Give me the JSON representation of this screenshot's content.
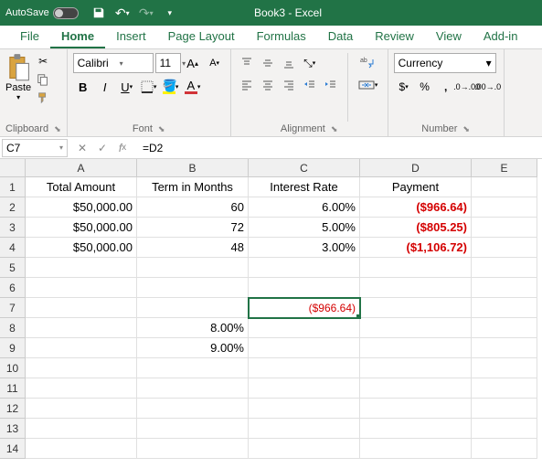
{
  "titlebar": {
    "autosave": "AutoSave",
    "doc": "Book3  -  Excel"
  },
  "tabs": [
    "File",
    "Home",
    "Insert",
    "Page Layout",
    "Formulas",
    "Data",
    "Review",
    "View",
    "Add-in"
  ],
  "active_tab": 1,
  "ribbon": {
    "clipboard": {
      "paste": "Paste",
      "label": "Clipboard"
    },
    "font": {
      "name": "Calibri",
      "size": "11",
      "label": "Font"
    },
    "alignment": {
      "label": "Alignment"
    },
    "number": {
      "format": "Currency",
      "label": "Number"
    }
  },
  "namebox": "C7",
  "formula": "=D2",
  "columns": [
    "A",
    "B",
    "C",
    "D",
    "E"
  ],
  "rows": [
    "1",
    "2",
    "3",
    "4",
    "5",
    "6",
    "7",
    "8",
    "9",
    "10",
    "11",
    "12",
    "13",
    "14"
  ],
  "col_widths": [
    "wA",
    "wB",
    "wC",
    "wD",
    "wE"
  ],
  "sheet": {
    "headers": [
      "Total Amount",
      "Term in Months",
      "Interest Rate",
      "Payment"
    ],
    "r2": {
      "a": "$50,000.00",
      "b": "60",
      "c": "6.00%",
      "d": "($966.64)"
    },
    "r3": {
      "a": "$50,000.00",
      "b": "72",
      "c": "5.00%",
      "d": "($805.25)"
    },
    "r4": {
      "a": "$50,000.00",
      "b": "48",
      "c": "3.00%",
      "d": "($1,106.72)"
    },
    "r7": {
      "c": "($966.64)"
    },
    "r8": {
      "b": "8.00%"
    },
    "r9": {
      "b": "9.00%"
    }
  }
}
